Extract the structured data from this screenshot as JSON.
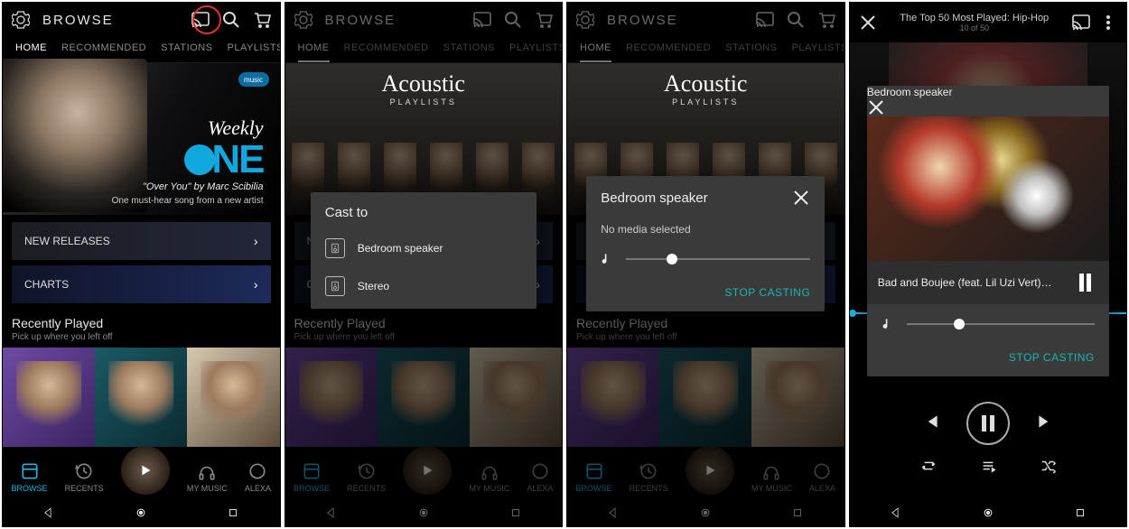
{
  "header": {
    "title": "BROWSE",
    "tabs": [
      "HOME",
      "RECOMMENDED",
      "STATIONS",
      "PLAYLISTS"
    ]
  },
  "hero_weekly": {
    "badge": "music",
    "line1": "Weekly",
    "line2": "NE",
    "sub_italic": "\"Over You\" by Marc Scibilia",
    "sub2": "One must-hear song from a new artist"
  },
  "hero_acoustic": {
    "title": "Acoustic",
    "sub": "PLAYLISTS"
  },
  "rows": {
    "new_releases": "NEW RELEASES",
    "charts": "CHARTS"
  },
  "recent": {
    "title": "Recently Played",
    "sub": "Pick up where you left off"
  },
  "bottom_nav": {
    "browse": "BROWSE",
    "recents": "RECENTS",
    "mymusic": "MY MUSIC",
    "alexa": "ALEXA"
  },
  "cast_dialog": {
    "title": "Cast to",
    "devices": [
      "Bedroom speaker",
      "Stereo"
    ]
  },
  "speaker_dialog": {
    "title": "Bedroom speaker",
    "no_media": "No media selected",
    "stop": "STOP CASTING",
    "volume_pct": 25
  },
  "player": {
    "playlist_title": "The Top 50 Most Played: Hip-Hop",
    "position": "10 of 50",
    "dialog_title": "Bedroom speaker",
    "song": "Bad and Boujee (feat. Lil Uzi Vert)…",
    "stop": "STOP CASTING",
    "volume_pct": 28
  }
}
